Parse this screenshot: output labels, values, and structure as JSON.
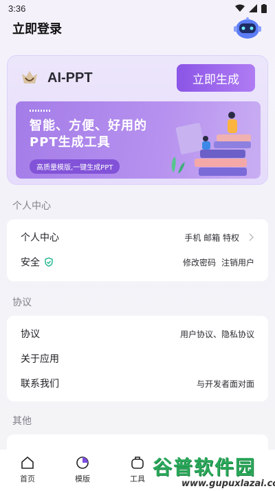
{
  "status_bar": {
    "time": "3:36"
  },
  "header": {
    "title": "立即登录"
  },
  "promo": {
    "app_name": "AI-PPT",
    "generate_label": "立即生成",
    "banner_line1": "智能、方便、好用的",
    "banner_line2": "PPT生成工具",
    "banner_sub": "高质量模版,一键生成PPT"
  },
  "personal": {
    "section_title": "个人中心",
    "rows": [
      {
        "label": "个人中心",
        "value": "手机 邮箱 特权"
      },
      {
        "label": "安全",
        "value_a": "修改密码",
        "value_b": "注销用户"
      }
    ]
  },
  "agreement": {
    "section_title": "协议",
    "rows": [
      {
        "label": "协议",
        "value": "用户协议、隐私协议"
      },
      {
        "label": "关于应用",
        "value": ""
      },
      {
        "label": "联系我们",
        "value": "与开发者面对面"
      }
    ]
  },
  "other": {
    "section_title": "其他"
  },
  "tabs": [
    {
      "label": "首页",
      "icon": "home-icon"
    },
    {
      "label": "模版",
      "icon": "template-icon"
    },
    {
      "label": "工具",
      "icon": "tools-icon"
    }
  ],
  "watermark": {
    "title": "谷普软件园",
    "url": "www.gupuxlazai.com"
  },
  "colors": {
    "accent": "#8b55e6",
    "shield": "#19b38a"
  }
}
